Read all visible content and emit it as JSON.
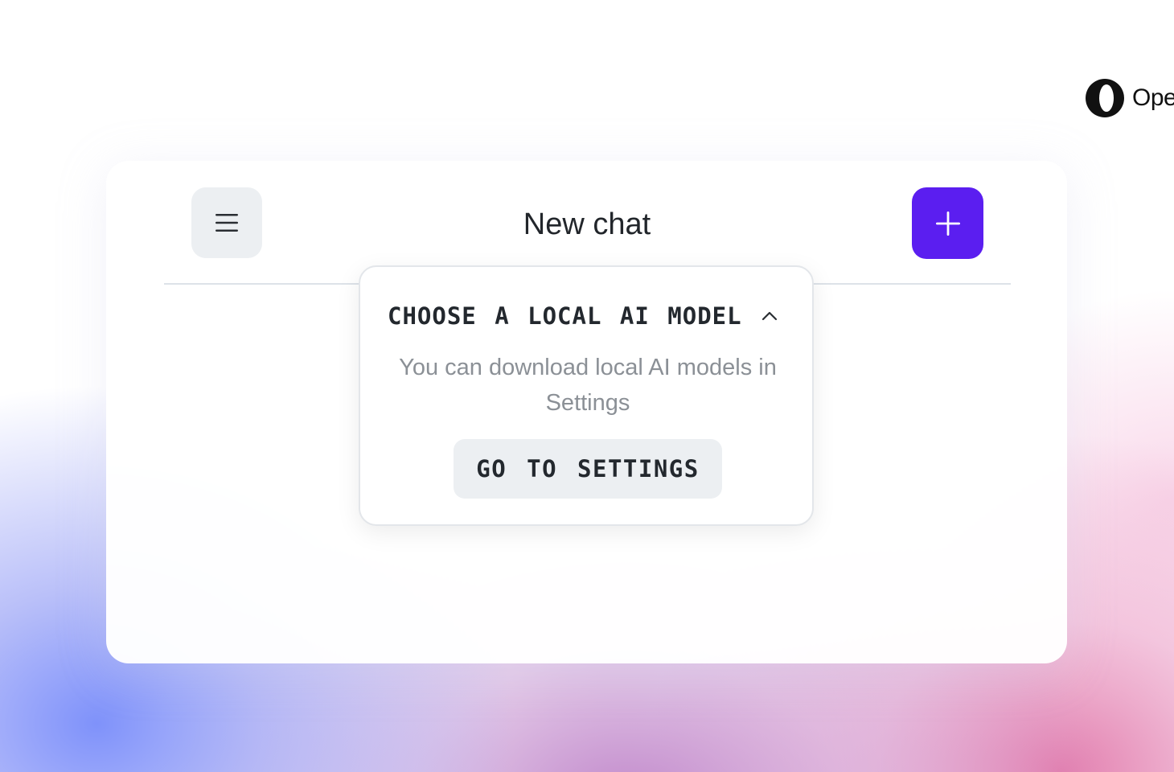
{
  "brand": {
    "text": "Ope",
    "logo_icon": "opera-logo-icon"
  },
  "header": {
    "title": "New chat",
    "menu_icon": "hamburger-menu-icon",
    "add_icon": "plus-icon",
    "accent_color": "#5b1ef0"
  },
  "model_popup": {
    "title": "CHOOSE A LOCAL AI MODEL",
    "chevron_icon": "chevron-up-icon",
    "description": "You can download local AI models in Settings",
    "button_label": "GO TO SETTINGS"
  }
}
